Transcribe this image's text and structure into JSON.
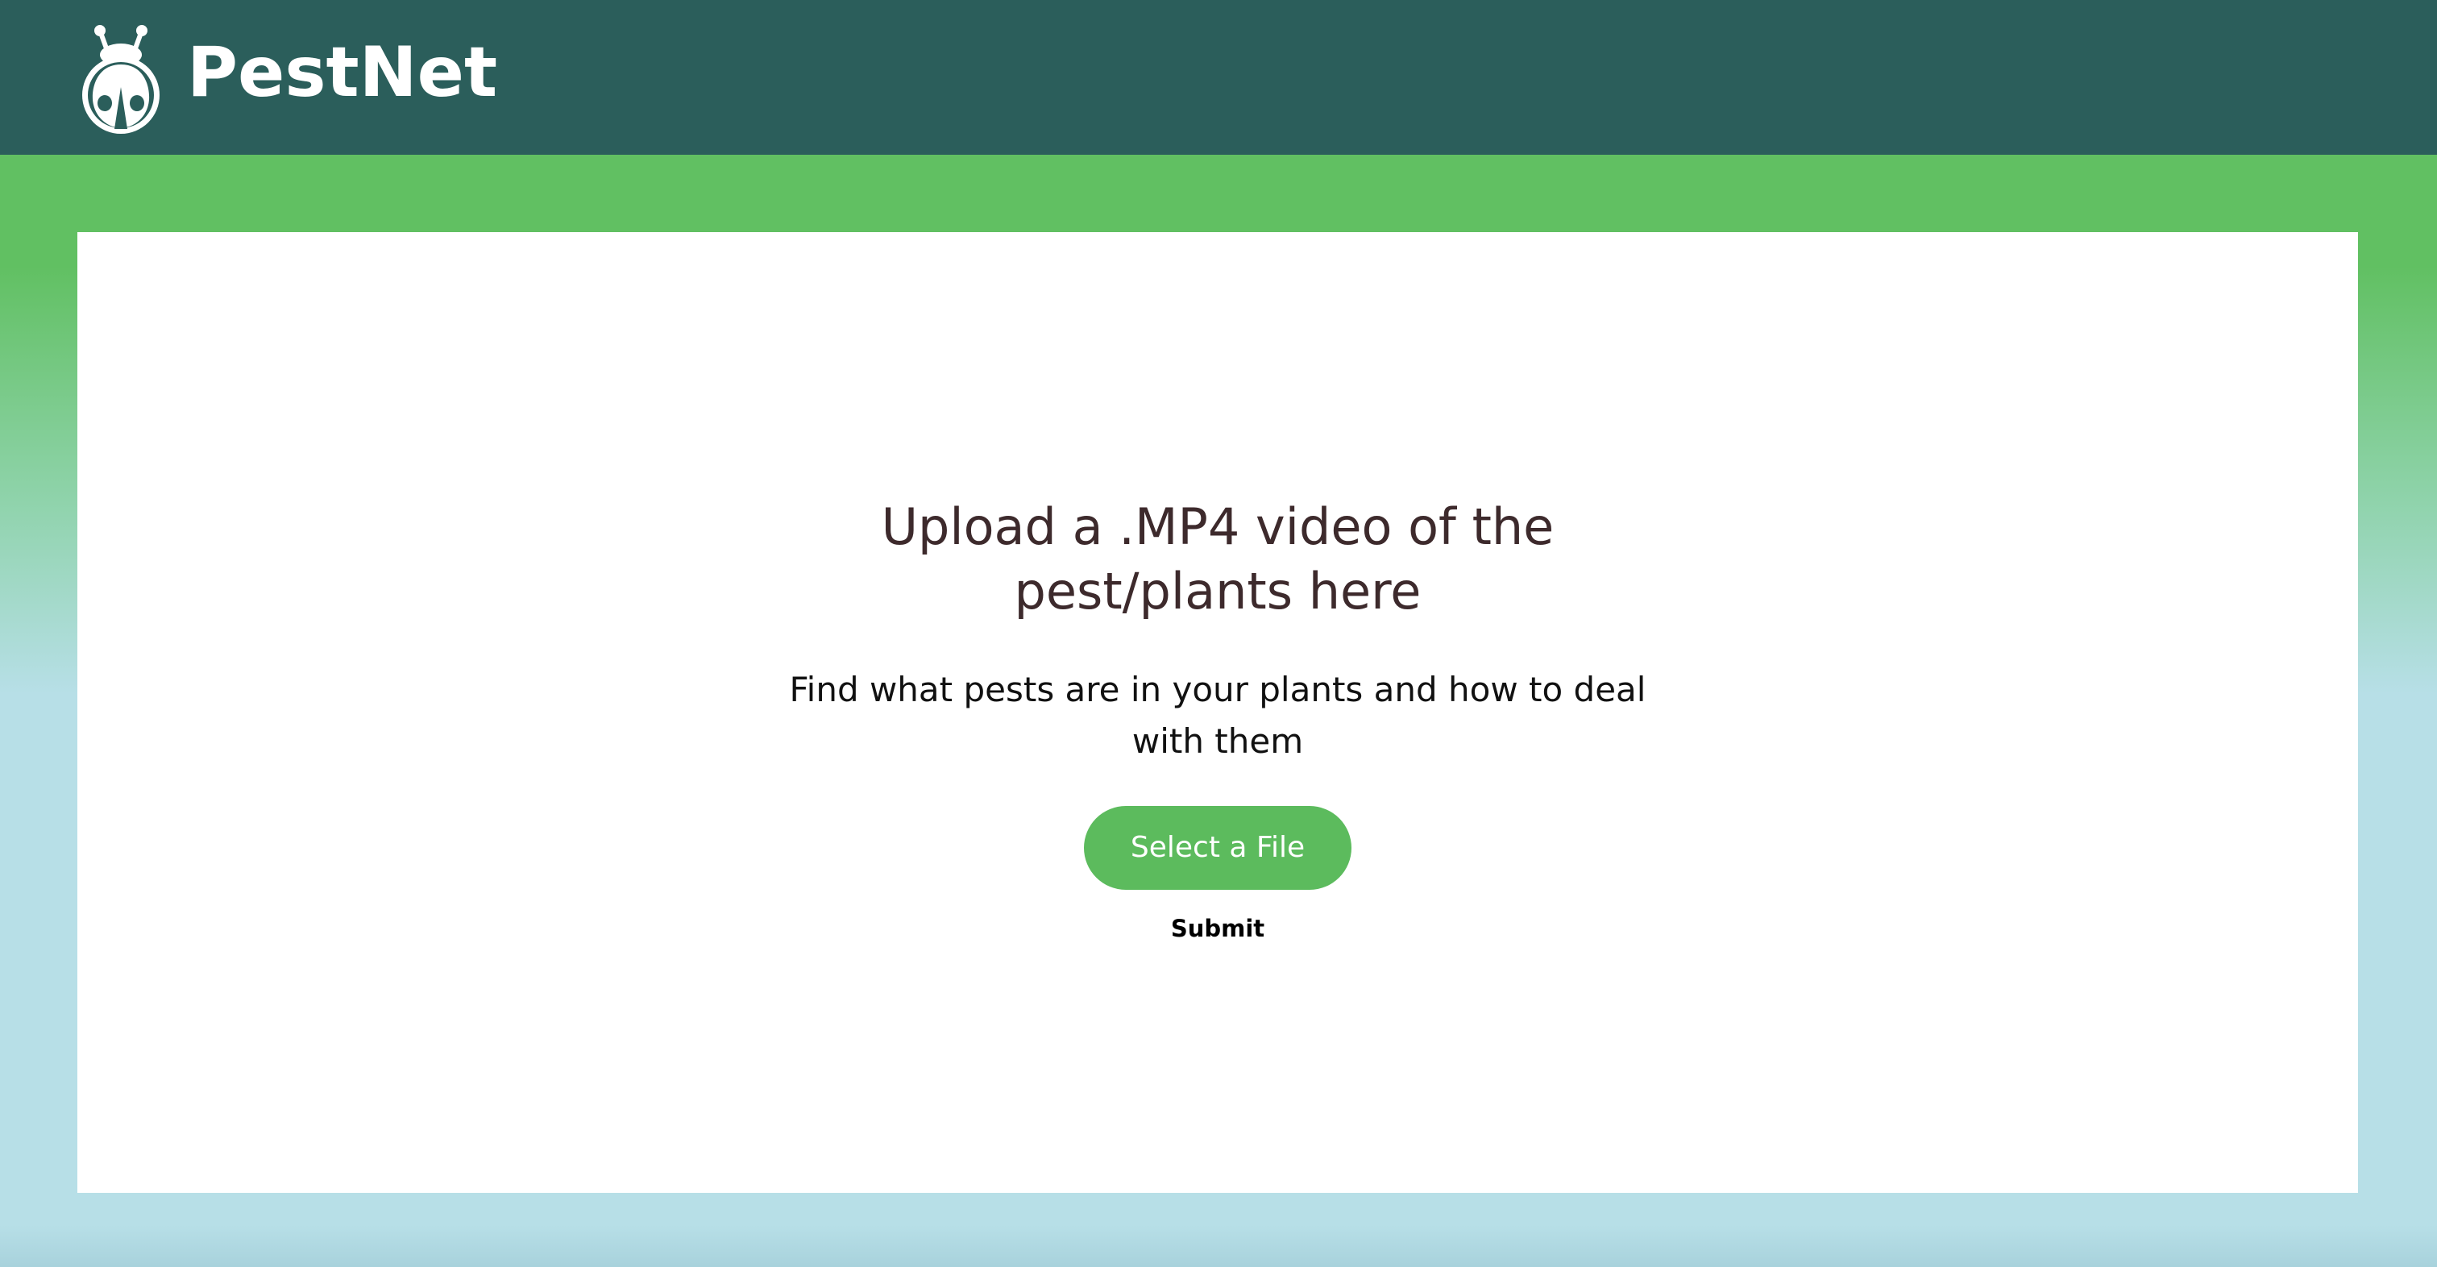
{
  "header": {
    "brand": "PestNet",
    "logo_icon": "ladybug-icon",
    "background_color": "#2b5e5b"
  },
  "upload": {
    "title": "Upload a .MP4 video of the pest/plants here",
    "subtitle": "Find what pests are in your plants and how to deal with them",
    "select_label": "Select a File",
    "submit_label": "Submit",
    "accent_color": "#5cbb5d"
  }
}
